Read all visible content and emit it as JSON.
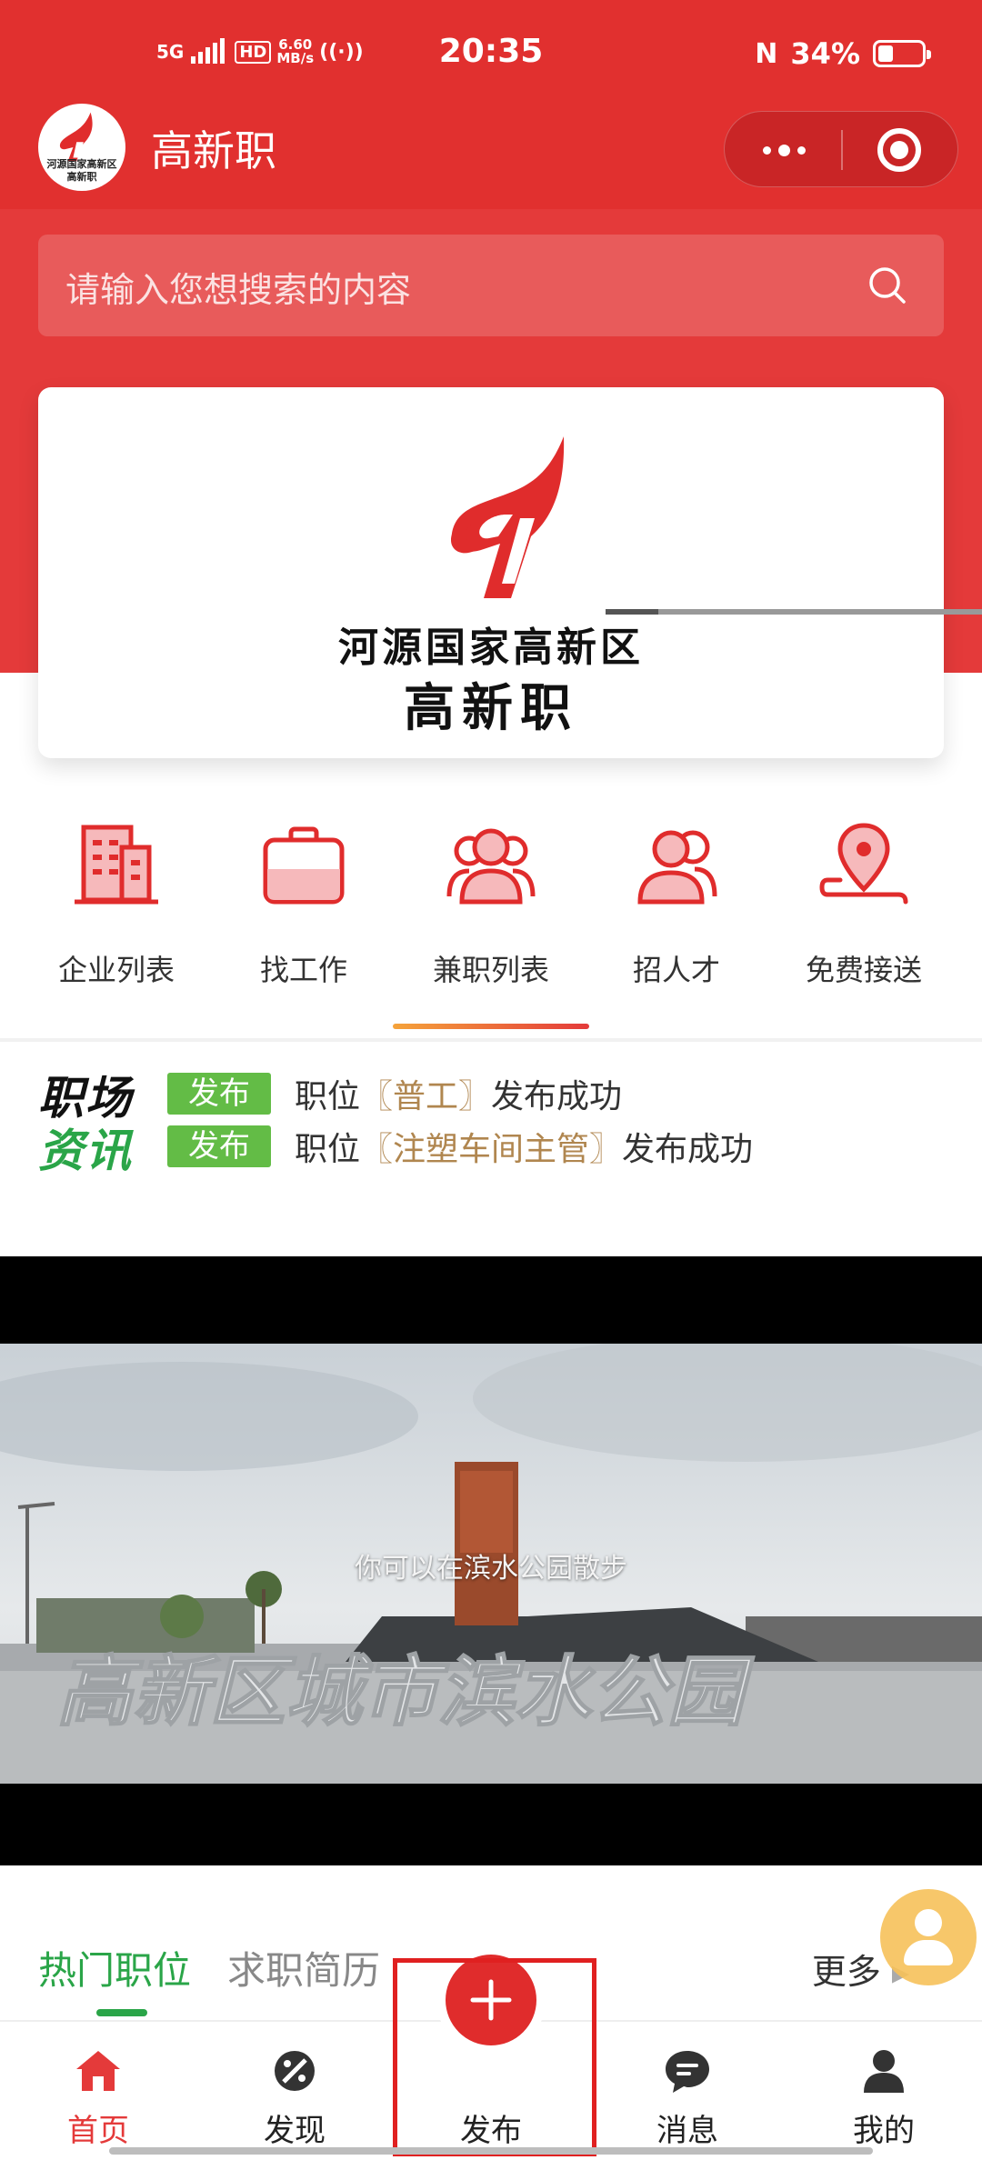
{
  "status_bar": {
    "network": "5G",
    "hd": "HD",
    "speed_value": "6.60",
    "speed_unit": "MB/s",
    "time": "20:35",
    "nfc": "N",
    "battery": "34%",
    "battery_level": 0.34
  },
  "nav": {
    "logo_line1": "河源国家高新区",
    "logo_line2": "高新职",
    "title": "高新职"
  },
  "search": {
    "placeholder": "请输入您想搜索的内容"
  },
  "banner": {
    "line1": "河源国家高新区",
    "line2": "高新职"
  },
  "menu": {
    "items": [
      {
        "label": "企业列表",
        "icon": "building-icon"
      },
      {
        "label": "找工作",
        "icon": "briefcase-icon"
      },
      {
        "label": "兼职列表",
        "icon": "group-icon"
      },
      {
        "label": "招人才",
        "icon": "person-icon"
      },
      {
        "label": "免费接送",
        "icon": "location-pin-icon"
      }
    ]
  },
  "news": {
    "tag_line1": "职场",
    "tag_line2": "资讯",
    "items": [
      {
        "badge": "发布",
        "prefix": "职位",
        "job": "〖普工〗",
        "suffix": "发布成功"
      },
      {
        "badge": "发布",
        "prefix": "职位",
        "job": "〖注塑车间主管〗",
        "suffix": "发布成功"
      }
    ]
  },
  "video": {
    "subtitle": "你可以在滨水公园散步",
    "sign_text": "高新区城市滨水公园",
    "progress": 0.14
  },
  "tabs": {
    "active": "热门职位",
    "inactive": "求职简历",
    "more": "更多"
  },
  "tabbar": {
    "items": [
      {
        "label": "首页",
        "icon": "home-icon"
      },
      {
        "label": "发现",
        "icon": "discover-icon"
      },
      {
        "label": "发布",
        "icon": "plus-icon"
      },
      {
        "label": "消息",
        "icon": "message-icon"
      },
      {
        "label": "我的",
        "icon": "profile-icon"
      }
    ]
  },
  "colors": {
    "brand_red": "#e43a3a",
    "accent_green": "#2aa548",
    "badge_green": "#63bc46"
  }
}
